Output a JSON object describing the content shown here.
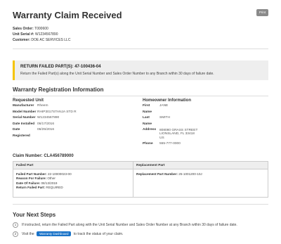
{
  "header": {
    "title": "Warranty Claim Received",
    "print_label": "Print"
  },
  "meta": [
    {
      "label": "Sales Order:",
      "value": "T000600"
    },
    {
      "label": "Unit Serial #:",
      "value": "W1234567890"
    },
    {
      "label": "Customer:",
      "value": "DOE AC SERVICES LLC"
    }
  ],
  "alert": {
    "title": "RETURN FAILED PART(S): 47-100436-04",
    "text": "Return the Failed Part(s) along the Unit Serial Number and Sales Order Number to any Branch within 30 days of failure date."
  },
  "registration": {
    "title": "Warranty Registration Information",
    "unit_title": "Requested Unit",
    "homeowner_title": "Homeowner Information",
    "unit": [
      {
        "label": "Manufacturer",
        "value": "Rheem"
      },
      {
        "label": "Model Number",
        "value": "RHIP3017STANJA STD R"
      },
      {
        "label": "Serial Number",
        "value": "W1234567890"
      },
      {
        "label": "Date Installed",
        "value": "06/17/2016"
      },
      {
        "label": "Date Registered",
        "value": "06/25/2016"
      }
    ],
    "homeowner": {
      "first_name_label": "First Name",
      "first_name": "JANE",
      "last_name_label": "Last Name",
      "last_name": "SMITH",
      "address_label": "Address",
      "address_lines": [
        "808080 GRASS STREET",
        "LIONSLAND, FL 33418",
        "US"
      ],
      "phone_label": "Phone",
      "phone": "555-777-0000"
    }
  },
  "claim": {
    "number_label": "Claim Number:",
    "number": "CLA456789000",
    "failed_part_header": "Failed Part",
    "replacement_part_header": "Replacement Part",
    "failed": [
      {
        "label": "Failed Part Number:",
        "value": "22-10000023-00"
      },
      {
        "label": "Reason For Failure:",
        "value": "Other"
      },
      {
        "label": "Date Of Failure:",
        "value": "08/13/2019"
      },
      {
        "label": "Return Failed Part:",
        "value": "REQUIRED"
      }
    ],
    "replacement_label": "Replacement Part Number:",
    "replacement_value": "25-1001200-10J"
  },
  "next_steps": {
    "title": "Your Next Steps",
    "step1_num": "1",
    "step1_text": "If instructed, return the Failed Part along with the Unit Serial Number and Sales Order Number at any Branch within 30 days of failure date.",
    "step2_num": "2",
    "step2_before": "Visit the",
    "step2_button": "Warranty Dashboard",
    "step2_after": "to track the status of your claim."
  }
}
